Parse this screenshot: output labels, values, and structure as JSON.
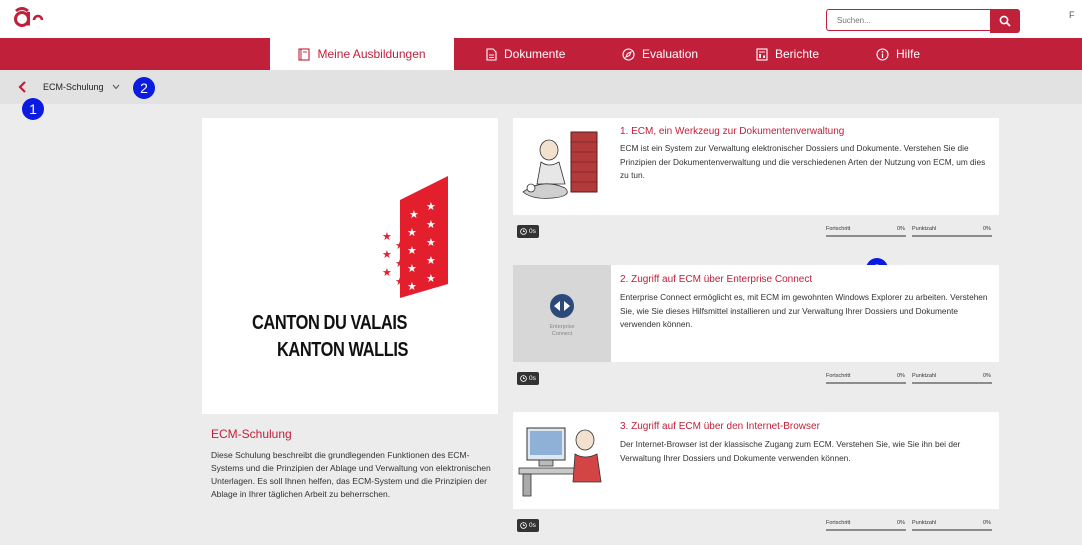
{
  "header": {
    "logo_text": "a",
    "search_placeholder": "Suchen...",
    "corner_letter": "F"
  },
  "nav": {
    "items": [
      {
        "label": "Meine Ausbildungen",
        "icon": "book-icon",
        "active": true
      },
      {
        "label": "Dokumente",
        "icon": "document-icon",
        "active": false
      },
      {
        "label": "Evaluation",
        "icon": "compass-icon",
        "active": false
      },
      {
        "label": "Berichte",
        "icon": "report-icon",
        "active": false
      },
      {
        "label": "Hilfe",
        "icon": "info-icon",
        "active": false
      }
    ]
  },
  "breadcrumb": {
    "selected": "ECM-Schulung"
  },
  "badges": [
    "1",
    "2",
    "3"
  ],
  "training": {
    "logo_line1": "CANTON DU VALAIS",
    "logo_line2": "KANTON WALLIS",
    "title": "ECM-Schulung",
    "description": "Diese Schulung beschreibt die grundlegenden Funktionen des ECM-Systems und die Prinzipien der Ablage und Verwaltung von elektronischen Unterlagen. Es soll Ihnen helfen, das ECM-System und die Prinzipien der Ablage in Ihrer täglichen Arbeit zu beherrschen."
  },
  "labels": {
    "progress": "Fortschritt",
    "score": "Punktzahl"
  },
  "courses": [
    {
      "title": "1. ECM, ein Werkzeug zur Dokumentenverwaltung",
      "description": "ECM ist ein System zur Verwaltung elektronischer Dossiers und Dokumente. Verstehen Sie die Prinzipien der Dokumentenverwaltung und die verschiedenen Arten der Nutzung von ECM, um dies zu tun.",
      "time": "0s",
      "progress": "0%",
      "score": "0%"
    },
    {
      "title": "2. Zugriff auf ECM über Enterprise Connect",
      "description": "Enterprise Connect ermöglicht es, mit ECM im gewohnten Windows Explorer zu arbeiten. Verstehen Sie, wie Sie dieses Hilfsmittel installieren und zur Verwaltung Ihrer Dossiers und Dokumente verwenden können.",
      "time": "0s",
      "progress": "0%",
      "score": "0%",
      "thumb_text_line1": "Enterprise",
      "thumb_text_line2": "Connect"
    },
    {
      "title": "3. Zugriff auf ECM über den Internet-Browser",
      "description": "Der Internet-Browser ist der klassische Zugang zum ECM. Verstehen Sie, wie Sie ihn bei der Verwaltung Ihrer Dossiers und Dokumente verwenden können.",
      "time": "0s",
      "progress": "0%",
      "score": "0%"
    }
  ],
  "colors": {
    "brand": "#c1203b",
    "badge": "#0b1be0",
    "background": "#ececec"
  }
}
